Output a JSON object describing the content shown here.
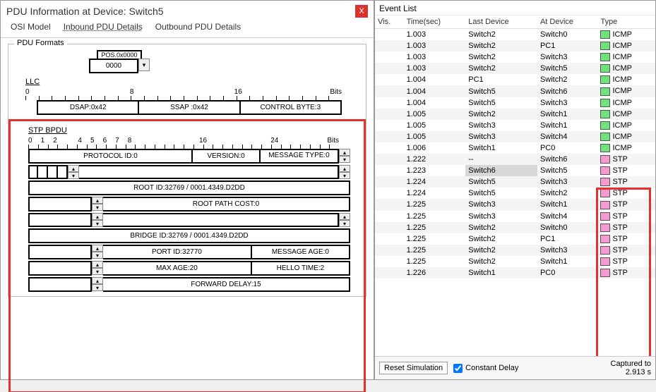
{
  "pdu": {
    "title": "PDU Information at Device: Switch5",
    "close": "X",
    "tabs": {
      "osi": "OSI Model",
      "inbound": "Inbound PDU Details",
      "outbound": "Outbound PDU Details"
    },
    "formats_legend": "PDU Formats",
    "top_field": "0000",
    "top_field_caption": "POS.0x0000",
    "llc": {
      "label": "LLC",
      "bit0": "0",
      "bit8": "8",
      "bit16": "16",
      "bits": "Bits",
      "dsap": "DSAP:0x42",
      "ssap": "SSAP :0x42",
      "ctrl": "CONTROL BYTE:3"
    },
    "stp": {
      "label": "STP BPDU",
      "t0": "0",
      "t1": "1",
      "t2": "2",
      "t4": "4",
      "t5": "5",
      "t6": "6",
      "t7": "7",
      "t8": "8",
      "t16": "16",
      "t24": "24",
      "bits": "Bits",
      "proto": "PROTOCOL ID:0",
      "version": "VERSION:0",
      "msgtype": "MESSAGE TYPE:0",
      "rootid": "ROOT ID:32769 / 0001.4349.D2DD",
      "rpc": "ROOT PATH COST:0",
      "bridgeid": "BRIDGE ID:32769 / 0001.4349.D2DD",
      "portid": "PORT ID:32770",
      "msgage": "MESSAGE AGE:0",
      "maxage": "MAX AGE:20",
      "hello": "HELLO TIME:2",
      "fwd": "FORWARD DELAY:15"
    }
  },
  "events": {
    "title": "Event List",
    "cols": {
      "vis": "Vis.",
      "time": "Time(sec)",
      "last": "Last Device",
      "at": "At Device",
      "type": "Type"
    },
    "rows": [
      {
        "time": "1.003",
        "last": "Switch2",
        "at": "Switch0",
        "type": "ICMP",
        "c": "icmp"
      },
      {
        "time": "1.003",
        "last": "Switch2",
        "at": "PC1",
        "type": "ICMP",
        "c": "icmp"
      },
      {
        "time": "1.003",
        "last": "Switch2",
        "at": "Switch3",
        "type": "ICMP",
        "c": "icmp"
      },
      {
        "time": "1.003",
        "last": "Switch2",
        "at": "Switch5",
        "type": "ICMP",
        "c": "icmp"
      },
      {
        "time": "1.004",
        "last": "PC1",
        "at": "Switch2",
        "type": "ICMP",
        "c": "icmp"
      },
      {
        "time": "1.004",
        "last": "Switch5",
        "at": "Switch6",
        "type": "ICMP",
        "c": "icmp"
      },
      {
        "time": "1.004",
        "last": "Switch5",
        "at": "Switch3",
        "type": "ICMP",
        "c": "icmp"
      },
      {
        "time": "1.005",
        "last": "Switch2",
        "at": "Switch1",
        "type": "ICMP",
        "c": "icmp"
      },
      {
        "time": "1.005",
        "last": "Switch3",
        "at": "Switch1",
        "type": "ICMP",
        "c": "icmp"
      },
      {
        "time": "1.005",
        "last": "Switch3",
        "at": "Switch4",
        "type": "ICMP",
        "c": "icmp"
      },
      {
        "time": "1.006",
        "last": "Switch1",
        "at": "PC0",
        "type": "ICMP",
        "c": "icmp"
      },
      {
        "time": "1.222",
        "last": "--",
        "at": "Switch6",
        "type": "STP",
        "c": "stp"
      },
      {
        "time": "1.223",
        "last": "Switch6",
        "at": "Switch5",
        "type": "STP",
        "c": "stp",
        "hl": true
      },
      {
        "time": "1.224",
        "last": "Switch5",
        "at": "Switch3",
        "type": "STP",
        "c": "stp"
      },
      {
        "time": "1.224",
        "last": "Switch5",
        "at": "Switch2",
        "type": "STP",
        "c": "stp"
      },
      {
        "time": "1.225",
        "last": "Switch3",
        "at": "Switch1",
        "type": "STP",
        "c": "stp"
      },
      {
        "time": "1.225",
        "last": "Switch3",
        "at": "Switch4",
        "type": "STP",
        "c": "stp"
      },
      {
        "time": "1.225",
        "last": "Switch2",
        "at": "Switch0",
        "type": "STP",
        "c": "stp"
      },
      {
        "time": "1.225",
        "last": "Switch2",
        "at": "PC1",
        "type": "STP",
        "c": "stp"
      },
      {
        "time": "1.225",
        "last": "Switch2",
        "at": "Switch3",
        "type": "STP",
        "c": "stp"
      },
      {
        "time": "1.225",
        "last": "Switch2",
        "at": "Switch1",
        "type": "STP",
        "c": "stp"
      },
      {
        "time": "1.226",
        "last": "Switch1",
        "at": "PC0",
        "type": "STP",
        "c": "stp"
      }
    ],
    "reset": "Reset Simulation",
    "const_delay": "Constant Delay",
    "captured1": "Captured to",
    "captured2": "2.913 s"
  }
}
